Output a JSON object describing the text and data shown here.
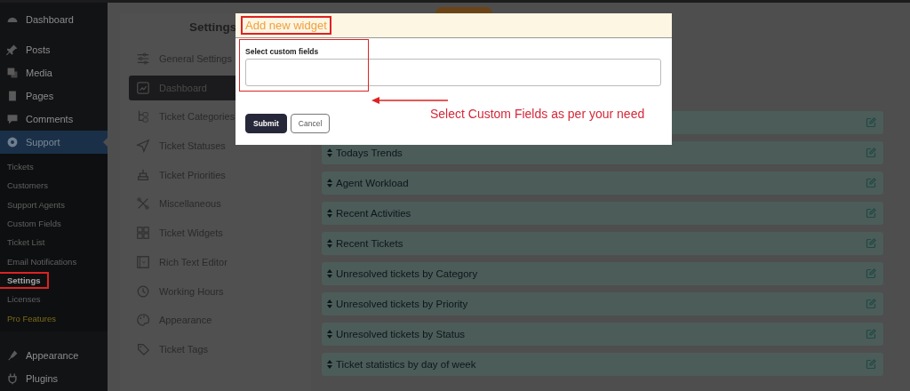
{
  "sidebar": {
    "menu": [
      {
        "label": "Dashboard",
        "selected": false
      },
      {
        "label": "Posts",
        "selected": false
      },
      {
        "label": "Media",
        "selected": false
      },
      {
        "label": "Pages",
        "selected": false
      },
      {
        "label": "Comments",
        "selected": false
      },
      {
        "label": "Support",
        "selected": true,
        "children": [
          {
            "label": "Tickets",
            "selected": false,
            "kind": "normal",
            "annotated": false
          },
          {
            "label": "Customers",
            "selected": false,
            "kind": "normal",
            "annotated": false
          },
          {
            "label": "Support Agents",
            "selected": false,
            "kind": "normal",
            "annotated": false
          },
          {
            "label": "Custom Fields",
            "selected": false,
            "kind": "normal",
            "annotated": false
          },
          {
            "label": "Ticket List",
            "selected": false,
            "kind": "normal",
            "annotated": false
          },
          {
            "label": "Email Notifications",
            "selected": false,
            "kind": "normal",
            "annotated": false
          },
          {
            "label": "Settings",
            "selected": true,
            "kind": "normal",
            "annotated": true
          },
          {
            "label": "Licenses",
            "selected": false,
            "kind": "normal",
            "annotated": false
          },
          {
            "label": "Pro Features",
            "selected": false,
            "kind": "pro",
            "annotated": false
          }
        ]
      },
      {
        "label": "Appearance",
        "selected": false
      },
      {
        "label": "Plugins",
        "selected": false
      }
    ]
  },
  "settings": {
    "title": "Settings",
    "items": [
      {
        "label": "General Settings",
        "selected": false
      },
      {
        "label": "Dashboard",
        "selected": true
      },
      {
        "label": "Ticket Categories",
        "selected": false
      },
      {
        "label": "Ticket Statuses",
        "selected": false
      },
      {
        "label": "Ticket Priorities",
        "selected": false
      },
      {
        "label": "Miscellaneous",
        "selected": false
      },
      {
        "label": "Ticket Widgets",
        "selected": false
      },
      {
        "label": "Rich Text Editor",
        "selected": false
      },
      {
        "label": "Working Hours",
        "selected": false
      },
      {
        "label": "Appearance",
        "selected": false
      },
      {
        "label": "Ticket Tags",
        "selected": false
      }
    ]
  },
  "widgets": [
    {
      "kind": "covered"
    },
    {
      "kind": "row",
      "label": "Todays Trends"
    },
    {
      "kind": "row",
      "label": "Agent Workload"
    },
    {
      "kind": "row",
      "label": "Recent Activities"
    },
    {
      "kind": "row",
      "label": "Recent Tickets"
    },
    {
      "kind": "row",
      "label": "Unresolved tickets by Category"
    },
    {
      "kind": "row",
      "label": "Unresolved tickets by Priority"
    },
    {
      "kind": "row",
      "label": "Unresolved tickets by Status"
    },
    {
      "kind": "row",
      "label": "Ticket statistics by day of week"
    }
  ],
  "modal": {
    "title": "Add new widget",
    "title_annotated": true,
    "field_label": "Select custom fields",
    "field_annotated": true,
    "buttons": [
      {
        "label": "Submit",
        "kind": "primary"
      },
      {
        "label": "Cancel",
        "kind": "secondary"
      }
    ]
  },
  "annotation": {
    "text": "Select Custom Fields as per your need"
  }
}
